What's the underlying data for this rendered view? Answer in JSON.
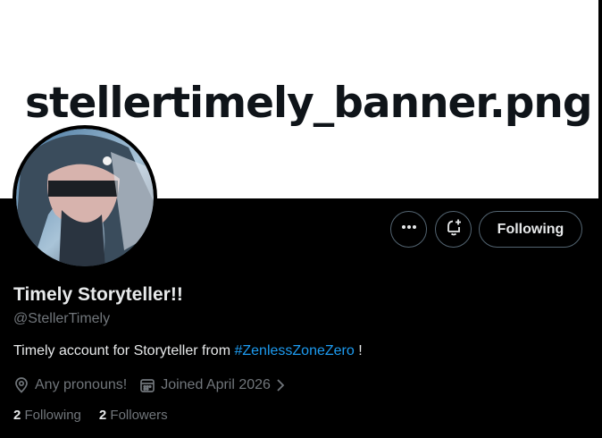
{
  "banner": {
    "text": "stellertimely_banner.png"
  },
  "actions": {
    "following_label": "Following"
  },
  "profile": {
    "name": "Timely Storyteller!!",
    "handle": "@StellerTimely",
    "bio_prefix": "Timely account for Storyteller from ",
    "bio_hashtag": "#ZenlessZoneZero",
    "bio_suffix": " !",
    "pronouns": "Any pronouns!",
    "joined": "Joined April 2026",
    "following_count": "2",
    "following_label": "Following",
    "followers_count": "2",
    "followers_label": "Followers"
  },
  "colors": {
    "background": "#000000",
    "text": "#e7e9ea",
    "muted": "#71767b",
    "link": "#1d9bf0",
    "border": "#536471"
  },
  "icons": [
    "more-icon",
    "notification-bell-plus-icon",
    "location-pin-icon",
    "calendar-icon",
    "chevron-right-icon"
  ]
}
